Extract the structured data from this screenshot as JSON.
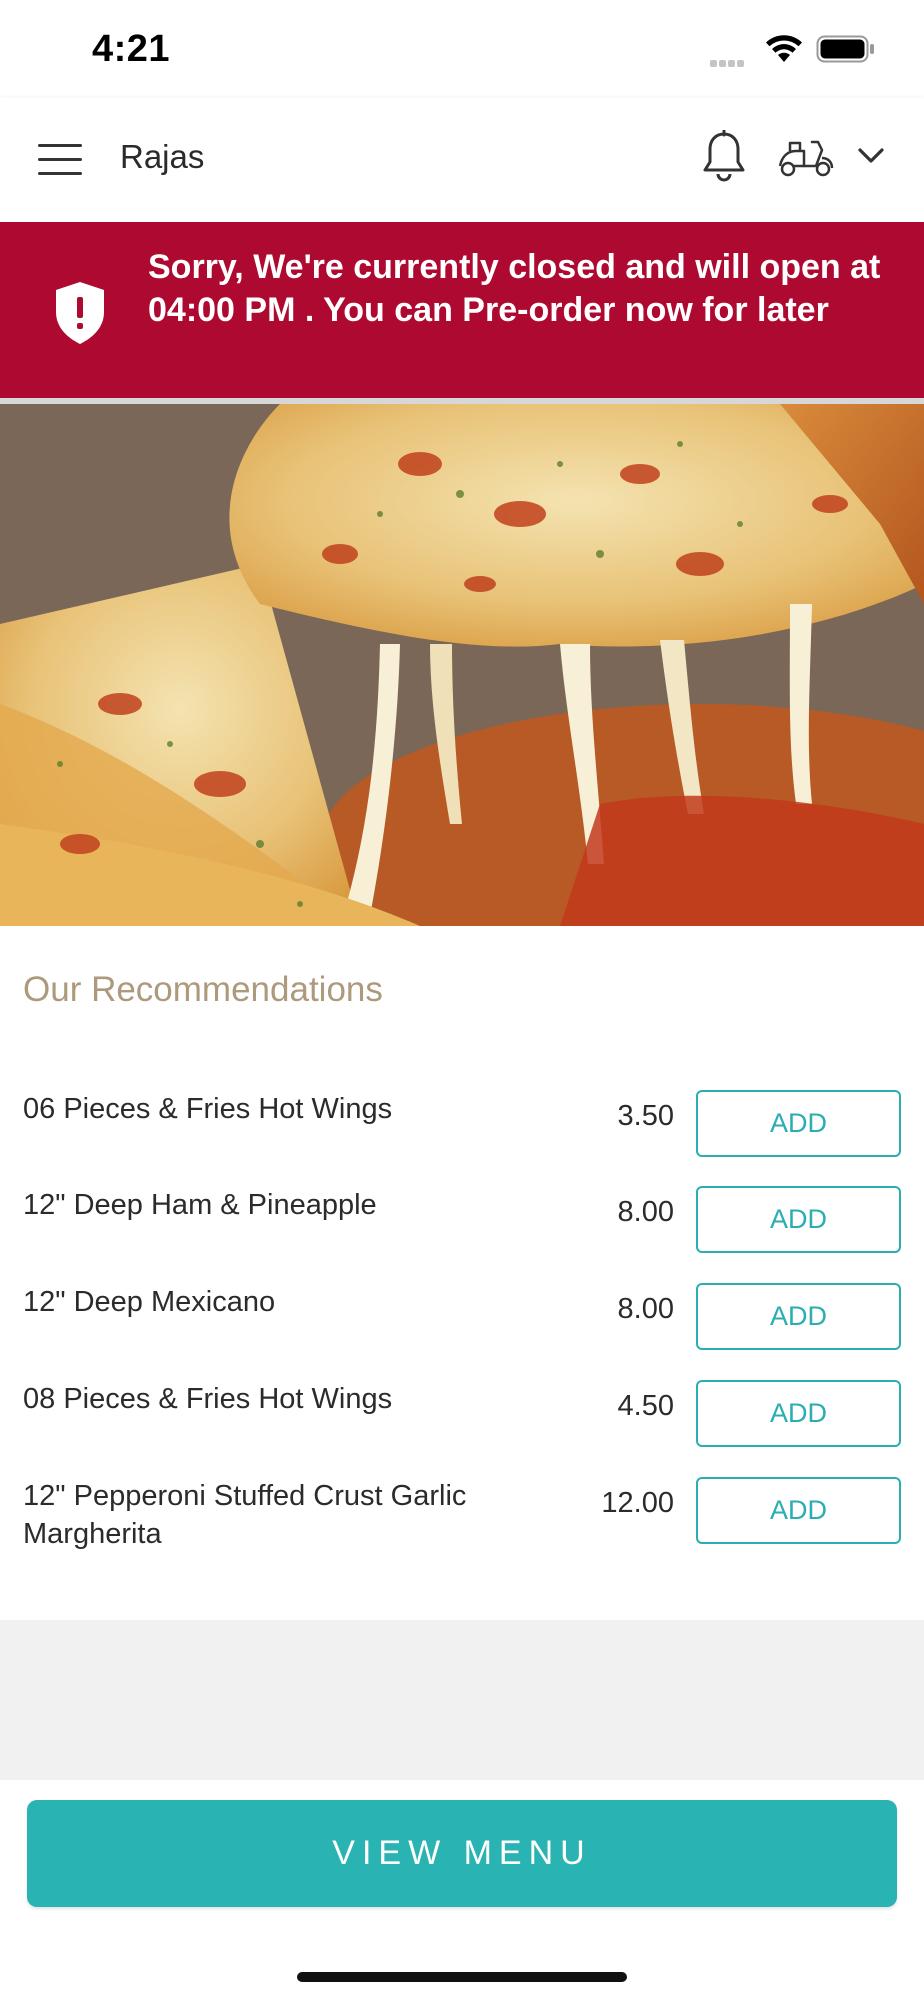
{
  "status_bar": {
    "time": "4:21"
  },
  "header": {
    "store_name": "Rajas"
  },
  "banner": {
    "message": "Sorry, We're currently closed and will open at 04:00 PM . You can Pre-order now for later",
    "color": "#ae0a31"
  },
  "recommendations": {
    "title": "Our Recommendations",
    "items": [
      {
        "name": "06 Pieces & Fries Hot Wings",
        "price": "3.50",
        "button": "ADD"
      },
      {
        "name": "12\" Deep Ham & Pineapple",
        "price": "8.00",
        "button": "ADD"
      },
      {
        "name": "12\" Deep Mexicano",
        "price": "8.00",
        "button": "ADD"
      },
      {
        "name": "08 Pieces & Fries Hot Wings",
        "price": "4.50",
        "button": "ADD"
      },
      {
        "name": "12\" Pepperoni Stuffed Crust Garlic Margherita",
        "price": "12.00",
        "button": "ADD"
      }
    ]
  },
  "footer": {
    "view_menu_label": "VIEW MENU"
  },
  "colors": {
    "accent": "#2ab3b3",
    "section_title": "#ad9a7c"
  }
}
